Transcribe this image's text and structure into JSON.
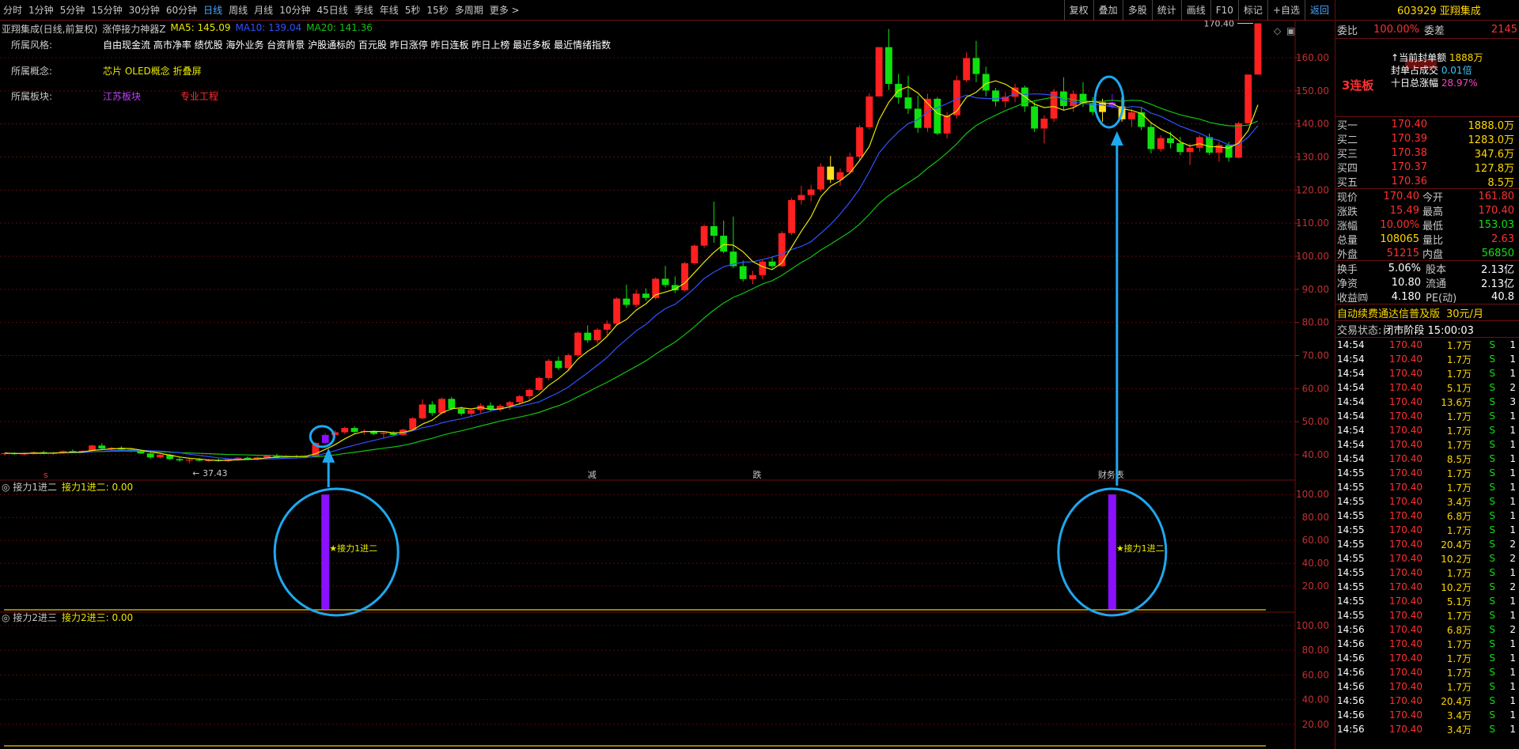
{
  "toolbar": {
    "periods": [
      "分时",
      "1分钟",
      "5分钟",
      "15分钟",
      "30分钟",
      "60分钟",
      "日线",
      "周线",
      "月线",
      "10分钟",
      "45日线",
      "季线",
      "年线",
      "5秒",
      "15秒",
      "多周期",
      "更多 >"
    ],
    "active_period": "日线",
    "tools": [
      "复权",
      "叠加",
      "多股",
      "统计",
      "画线",
      "F10",
      "标记",
      "+自选",
      "返回"
    ]
  },
  "chart": {
    "title": "亚翔集成(日线,前复权)",
    "indicator": "涨停接力神器Z",
    "ma5": "MA5: 145.09",
    "ma10": "MA10: 139.04",
    "ma20": "MA20: 141.36",
    "style_label": "所属风格:",
    "style_value": "自由现金流 高市净率 绩优股 海外业务 台资背景 沪股通标的 百元股 昨日涨停 昨日连板 昨日上榜 最近多板 最近情绪指数",
    "concept_label": "所属概念:",
    "concept_value": "芯片 OLED概念 折叠屏",
    "sector_label": "所属板块:",
    "sector_value1": "江苏板块",
    "sector_value2": "专业工程",
    "max_label": "170.40",
    "min_label": "37.43",
    "marker_jian": "减",
    "marker_die": "跌",
    "marker_caiwu": "财务表",
    "pane2_title": "接力1进二",
    "pane2_value": "接力1进二: 0.00",
    "pane2_signal": "接力1进二",
    "pane3_title": "接力2进三",
    "pane3_value": "接力2进三: 0.00",
    "price_axis": [
      "160.00",
      "150.00",
      "140.00",
      "130.00",
      "120.00",
      "110.00",
      "100.00",
      "90.00",
      "80.00",
      "70.00",
      "60.00",
      "50.00",
      "40.00"
    ],
    "sub_axis": [
      "100.00",
      "80.00",
      "60.00",
      "40.00",
      "20.00"
    ],
    "colors": {
      "up": "#ff2020",
      "down": "#10e010",
      "limit_up": "#ffe020",
      "signal": "#8a10ff",
      "ma5": "#e8e800",
      "ma10": "#2f52ff",
      "ma20": "#12c212",
      "annotation": "#1ea8f0"
    }
  },
  "chart_data": {
    "type": "candlestick",
    "ylim": [
      35,
      172
    ],
    "candles": [
      [
        40.2,
        40.6,
        39.8,
        40.5
      ],
      [
        40.5,
        40.8,
        40.0,
        40.3
      ],
      [
        40.3,
        40.7,
        39.9,
        40.4
      ],
      [
        40.4,
        41.0,
        40.1,
        40.8
      ],
      [
        40.8,
        41.2,
        40.2,
        40.4
      ],
      [
        40.4,
        40.9,
        40.0,
        40.6
      ],
      [
        40.6,
        41.3,
        40.3,
        41.1
      ],
      [
        41.1,
        41.6,
        40.7,
        40.9
      ],
      [
        40.9,
        41.4,
        40.5,
        41.2
      ],
      [
        41.2,
        43.0,
        41.0,
        42.8
      ],
      [
        42.8,
        43.5,
        41.6,
        41.9
      ],
      [
        41.9,
        42.4,
        41.2,
        42.1
      ],
      [
        42.1,
        42.6,
        41.4,
        41.6
      ],
      [
        41.6,
        42.0,
        40.8,
        41.1
      ],
      [
        41.1,
        41.5,
        40.2,
        40.4
      ],
      [
        40.4,
        40.8,
        38.8,
        39.2
      ],
      [
        39.2,
        40.2,
        38.9,
        40.0
      ],
      [
        40.0,
        40.3,
        38.4,
        38.7
      ],
      [
        38.7,
        39.2,
        37.9,
        38.3
      ],
      [
        38.3,
        38.8,
        37.43,
        38.5
      ],
      [
        38.5,
        39.0,
        38.0,
        38.2
      ],
      [
        38.2,
        38.7,
        37.8,
        38.4
      ],
      [
        38.4,
        38.9,
        37.9,
        38.1
      ],
      [
        38.1,
        38.8,
        37.8,
        38.6
      ],
      [
        38.6,
        39.3,
        38.2,
        39.1
      ],
      [
        39.1,
        39.5,
        38.5,
        38.8
      ],
      [
        38.8,
        39.4,
        38.3,
        39.2
      ],
      [
        39.2,
        40.0,
        38.9,
        39.8
      ],
      [
        39.8,
        40.3,
        39.0,
        39.4
      ],
      [
        39.4,
        39.9,
        38.9,
        39.6
      ],
      [
        39.6,
        39.9,
        39.0,
        39.3
      ],
      [
        39.3,
        39.7,
        38.9,
        39.6
      ],
      [
        39.6,
        43.8,
        39.6,
        43.6
      ],
      [
        43.6,
        46.5,
        43.4,
        46.0
      ],
      [
        46.0,
        47.3,
        45.2,
        46.8
      ],
      [
        46.8,
        48.5,
        46.3,
        48.1
      ],
      [
        48.1,
        48.6,
        46.4,
        46.9
      ],
      [
        46.9,
        47.7,
        46.1,
        47.2
      ],
      [
        47.2,
        47.4,
        45.9,
        46.3
      ],
      [
        46.3,
        46.9,
        45.2,
        46.6
      ],
      [
        46.6,
        47.1,
        45.8,
        46.0
      ],
      [
        46.0,
        47.9,
        45.7,
        47.6
      ],
      [
        47.6,
        51.4,
        47.4,
        51.0
      ],
      [
        51.0,
        56.8,
        50.8,
        55.2
      ],
      [
        55.2,
        56.2,
        51.8,
        52.6
      ],
      [
        52.6,
        57.3,
        52.3,
        56.9
      ],
      [
        56.9,
        57.5,
        53.4,
        53.9
      ],
      [
        53.9,
        54.6,
        51.8,
        52.4
      ],
      [
        52.4,
        53.9,
        51.6,
        53.5
      ],
      [
        53.5,
        55.6,
        52.6,
        54.9
      ],
      [
        54.9,
        55.9,
        53.2,
        53.7
      ],
      [
        53.7,
        55.3,
        53.1,
        54.8
      ],
      [
        54.8,
        56.3,
        53.6,
        55.9
      ],
      [
        55.9,
        58.1,
        55.1,
        57.7
      ],
      [
        57.7,
        60.1,
        56.5,
        59.6
      ],
      [
        59.6,
        63.6,
        59.1,
        63.2
      ],
      [
        63.2,
        68.9,
        62.6,
        68.4
      ],
      [
        68.4,
        69.7,
        65.6,
        66.2
      ],
      [
        66.2,
        70.6,
        65.4,
        70.1
      ],
      [
        70.1,
        77.3,
        69.6,
        76.9
      ],
      [
        76.9,
        79.1,
        73.9,
        74.6
      ],
      [
        74.6,
        78.3,
        73.6,
        77.8
      ],
      [
        77.8,
        80.6,
        76.1,
        79.6
      ],
      [
        79.6,
        87.6,
        79.2,
        87.2
      ],
      [
        87.2,
        91.4,
        84.4,
        85.3
      ],
      [
        85.3,
        89.9,
        84.6,
        88.7
      ],
      [
        88.7,
        90.3,
        86.6,
        87.4
      ],
      [
        87.4,
        93.6,
        86.9,
        93.2
      ],
      [
        93.2,
        97.1,
        90.6,
        91.3
      ],
      [
        91.3,
        93.9,
        88.9,
        89.7
      ],
      [
        89.7,
        98.3,
        89.3,
        97.9
      ],
      [
        97.9,
        103.6,
        97.4,
        103.2
      ],
      [
        103.2,
        109.6,
        102.6,
        109.1
      ],
      [
        109.1,
        116.5,
        104.1,
        106.2
      ],
      [
        106.2,
        110.8,
        100.9,
        101.4
      ],
      [
        101.4,
        112.0,
        96.4,
        97.0
      ],
      [
        97.0,
        98.7,
        92.3,
        93.1
      ],
      [
        93.1,
        95.6,
        91.6,
        94.3
      ],
      [
        94.3,
        99.1,
        93.1,
        98.4
      ],
      [
        98.4,
        99.6,
        96.3,
        97.0
      ],
      [
        97.0,
        107.6,
        96.8,
        107.0
      ],
      [
        107.0,
        117.6,
        106.4,
        117.0
      ],
      [
        117.0,
        121.3,
        115.6,
        118.5
      ],
      [
        118.5,
        121.6,
        116.6,
        120.2
      ],
      [
        120.2,
        128.1,
        119.6,
        127.1
      ],
      [
        127.1,
        130.3,
        122.1,
        123.1
      ],
      [
        123.1,
        126.6,
        121.3,
        125.4
      ],
      [
        125.4,
        131.3,
        124.9,
        130.1
      ],
      [
        130.1,
        139.6,
        129.1,
        139.0
      ],
      [
        139.0,
        149.3,
        138.3,
        148.3
      ],
      [
        148.3,
        163.2,
        148.3,
        163.2
      ],
      [
        163.2,
        168.7,
        150.3,
        152.1
      ],
      [
        152.1,
        155.1,
        146.1,
        148.0
      ],
      [
        148.0,
        154.6,
        143.0,
        144.6
      ],
      [
        144.6,
        148.6,
        137.3,
        138.8
      ],
      [
        138.8,
        149.1,
        137.6,
        147.6
      ],
      [
        147.6,
        148.1,
        136.6,
        137.1
      ],
      [
        137.1,
        143.6,
        135.6,
        142.6
      ],
      [
        142.6,
        154.6,
        141.6,
        153.2
      ],
      [
        153.2,
        161.6,
        152.6,
        159.9
      ],
      [
        159.9,
        165.1,
        152.6,
        155.1
      ],
      [
        155.1,
        157.3,
        148.3,
        150.1
      ],
      [
        150.1,
        150.9,
        145.3,
        146.8
      ],
      [
        146.8,
        149.6,
        145.0,
        148.2
      ],
      [
        148.2,
        152.1,
        146.6,
        151.0
      ],
      [
        151.0,
        151.6,
        143.6,
        145.3
      ],
      [
        145.3,
        146.6,
        137.6,
        138.6
      ],
      [
        138.6,
        142.6,
        134.1,
        141.6
      ],
      [
        141.6,
        150.6,
        140.6,
        149.8
      ],
      [
        149.8,
        154.1,
        144.1,
        145.4
      ],
      [
        145.4,
        150.1,
        143.6,
        149.1
      ],
      [
        149.1,
        152.6,
        145.1,
        146.3
      ],
      [
        146.3,
        148.1,
        142.6,
        143.6
      ],
      [
        143.6,
        147.6,
        140.6,
        146.5
      ],
      [
        146.5,
        149.1,
        144.6,
        145.3
      ],
      [
        145.3,
        148.1,
        140.6,
        141.4
      ],
      [
        141.4,
        144.6,
        139.1,
        143.5
      ],
      [
        143.5,
        145.1,
        138.1,
        139.1
      ],
      [
        139.1,
        140.6,
        131.1,
        132.4
      ],
      [
        132.4,
        136.6,
        131.6,
        135.7
      ],
      [
        135.7,
        137.6,
        132.6,
        134.2
      ],
      [
        134.2,
        136.1,
        130.6,
        131.5
      ],
      [
        131.5,
        134.1,
        127.6,
        132.8
      ],
      [
        132.8,
        136.6,
        131.6,
        136.0
      ],
      [
        136.0,
        137.1,
        130.6,
        131.3
      ],
      [
        131.3,
        134.6,
        128.6,
        133.6
      ],
      [
        133.6,
        134.6,
        128.6,
        129.8
      ],
      [
        129.8,
        140.6,
        129.6,
        140.2
      ],
      [
        140.2,
        154.91,
        140.2,
        154.91
      ],
      [
        154.91,
        170.4,
        154.91,
        170.4
      ]
    ],
    "signal_candles": [
      33,
      114
    ],
    "limit_up_candles": [
      85,
      113,
      115
    ],
    "pane2_bars": [
      {
        "index": 33,
        "value": 100
      },
      {
        "index": 114,
        "value": 100
      }
    ],
    "pane2_ylim": [
      0,
      105
    ],
    "pane3_ylim": [
      0,
      105
    ]
  },
  "right": {
    "code_name": "603929 亚翔集成",
    "weibi_label": "委比",
    "weibi_val": "100.00%",
    "weicha_label": "委差",
    "weicha_val": "2145",
    "board_label": "3连板",
    "fengdan_label": "当前封单额",
    "fengdan_val": "1888万",
    "fengdan_ratio_label": "封单占成交",
    "fengdan_ratio_val": "0.01倍",
    "ten_day_label": "十日总涨幅",
    "ten_day_val": "28.97%",
    "bids": [
      {
        "label": "买一",
        "price": "170.40",
        "vol": "1888.0万"
      },
      {
        "label": "买二",
        "price": "170.39",
        "vol": "1283.0万"
      },
      {
        "label": "买三",
        "price": "170.38",
        "vol": "347.6万"
      },
      {
        "label": "买四",
        "price": "170.37",
        "vol": "127.8万"
      },
      {
        "label": "买五",
        "price": "170.36",
        "vol": "8.5万"
      }
    ],
    "quotes": [
      {
        "l1": "现价",
        "v1": "170.40",
        "c1": "c-red",
        "l2": "今开",
        "v2": "161.80",
        "c2": "c-red"
      },
      {
        "l1": "涨跌",
        "v1": "15.49",
        "c1": "c-red",
        "l2": "最高",
        "v2": "170.40",
        "c2": "c-red"
      },
      {
        "l1": "涨幅",
        "v1": "10.00%",
        "c1": "c-red",
        "l2": "最低",
        "v2": "153.03",
        "c2": "c-grn"
      },
      {
        "l1": "总量",
        "v1": "108065",
        "c1": "c-yel",
        "l2": "量比",
        "v2": "2.63",
        "c2": "c-red"
      },
      {
        "l1": "外盘",
        "v1": "51215",
        "c1": "c-red",
        "l2": "内盘",
        "v2": "56850",
        "c2": "c-grn"
      }
    ],
    "stats": [
      {
        "l1": "换手",
        "v1": "5.06%",
        "l2": "股本",
        "v2": "2.13亿"
      },
      {
        "l1": "净资",
        "v1": "10.80",
        "l2": "流通",
        "v2": "2.13亿"
      },
      {
        "l1": "收益㈣",
        "v1": "4.180",
        "l2": "PE(动)",
        "v2": "40.8"
      }
    ],
    "promo": "自动续费通达信普及版",
    "promo_price": "30元/月",
    "trade_status_label": "交易状态:",
    "trade_status": "闭市阶段 15:00:03",
    "trades": [
      {
        "t": "14:54",
        "p": "170.40",
        "v": "1.7万",
        "s": "S",
        "n": "1"
      },
      {
        "t": "14:54",
        "p": "170.40",
        "v": "1.7万",
        "s": "S",
        "n": "1"
      },
      {
        "t": "14:54",
        "p": "170.40",
        "v": "1.7万",
        "s": "S",
        "n": "1"
      },
      {
        "t": "14:54",
        "p": "170.40",
        "v": "5.1万",
        "s": "S",
        "n": "2"
      },
      {
        "t": "14:54",
        "p": "170.40",
        "v": "13.6万",
        "s": "S",
        "n": "3"
      },
      {
        "t": "14:54",
        "p": "170.40",
        "v": "1.7万",
        "s": "S",
        "n": "1"
      },
      {
        "t": "14:54",
        "p": "170.40",
        "v": "1.7万",
        "s": "S",
        "n": "1"
      },
      {
        "t": "14:54",
        "p": "170.40",
        "v": "1.7万",
        "s": "S",
        "n": "1"
      },
      {
        "t": "14:54",
        "p": "170.40",
        "v": "8.5万",
        "s": "S",
        "n": "1"
      },
      {
        "t": "14:55",
        "p": "170.40",
        "v": "1.7万",
        "s": "S",
        "n": "1"
      },
      {
        "t": "14:55",
        "p": "170.40",
        "v": "1.7万",
        "s": "S",
        "n": "1"
      },
      {
        "t": "14:55",
        "p": "170.40",
        "v": "3.4万",
        "s": "S",
        "n": "1"
      },
      {
        "t": "14:55",
        "p": "170.40",
        "v": "6.8万",
        "s": "S",
        "n": "1"
      },
      {
        "t": "14:55",
        "p": "170.40",
        "v": "1.7万",
        "s": "S",
        "n": "1"
      },
      {
        "t": "14:55",
        "p": "170.40",
        "v": "20.4万",
        "s": "S",
        "n": "2"
      },
      {
        "t": "14:55",
        "p": "170.40",
        "v": "10.2万",
        "s": "S",
        "n": "2"
      },
      {
        "t": "14:55",
        "p": "170.40",
        "v": "1.7万",
        "s": "S",
        "n": "1"
      },
      {
        "t": "14:55",
        "p": "170.40",
        "v": "10.2万",
        "s": "S",
        "n": "2"
      },
      {
        "t": "14:55",
        "p": "170.40",
        "v": "5.1万",
        "s": "S",
        "n": "1"
      },
      {
        "t": "14:55",
        "p": "170.40",
        "v": "1.7万",
        "s": "S",
        "n": "1"
      },
      {
        "t": "14:56",
        "p": "170.40",
        "v": "6.8万",
        "s": "S",
        "n": "2"
      },
      {
        "t": "14:56",
        "p": "170.40",
        "v": "1.7万",
        "s": "S",
        "n": "1"
      },
      {
        "t": "14:56",
        "p": "170.40",
        "v": "1.7万",
        "s": "S",
        "n": "1"
      },
      {
        "t": "14:56",
        "p": "170.40",
        "v": "1.7万",
        "s": "S",
        "n": "1"
      },
      {
        "t": "14:56",
        "p": "170.40",
        "v": "1.7万",
        "s": "S",
        "n": "1"
      },
      {
        "t": "14:56",
        "p": "170.40",
        "v": "20.4万",
        "s": "S",
        "n": "1"
      },
      {
        "t": "14:56",
        "p": "170.40",
        "v": "3.4万",
        "s": "S",
        "n": "1"
      },
      {
        "t": "14:56",
        "p": "170.40",
        "v": "3.4万",
        "s": "S",
        "n": "1"
      }
    ]
  }
}
